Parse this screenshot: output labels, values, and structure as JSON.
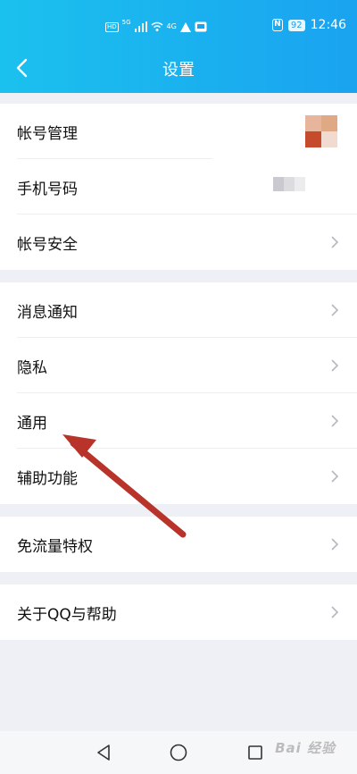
{
  "status_bar": {
    "left_badges": [
      "HD",
      "5G",
      "4G"
    ],
    "battery": "92",
    "time": "12:46"
  },
  "header": {
    "title": "设置"
  },
  "groups": [
    [
      {
        "label": "帐号管理",
        "accessory": "avatar"
      },
      {
        "label": "手机号码",
        "accessory": "blurred-value"
      },
      {
        "label": "帐号安全",
        "accessory": "chevron"
      }
    ],
    [
      {
        "label": "消息通知",
        "accessory": "chevron"
      },
      {
        "label": "隐私",
        "accessory": "chevron"
      },
      {
        "label": "通用",
        "accessory": "chevron"
      },
      {
        "label": "辅助功能",
        "accessory": "chevron"
      }
    ],
    [
      {
        "label": "免流量特权",
        "accessory": "chevron"
      }
    ],
    [
      {
        "label": "关于QQ与帮助",
        "accessory": "chevron"
      }
    ]
  ],
  "annotation": {
    "type": "red-arrow",
    "points_to": "通用",
    "color": "#b8342a"
  },
  "colors": {
    "header_start": "#1bc1ee",
    "header_end": "#1aa3f0",
    "background": "#eef0f5"
  },
  "nav_bar": {
    "icons": [
      "back-triangle-icon",
      "home-circle-icon",
      "recents-square-icon"
    ]
  },
  "watermark": {
    "text": "Bai 经验"
  }
}
